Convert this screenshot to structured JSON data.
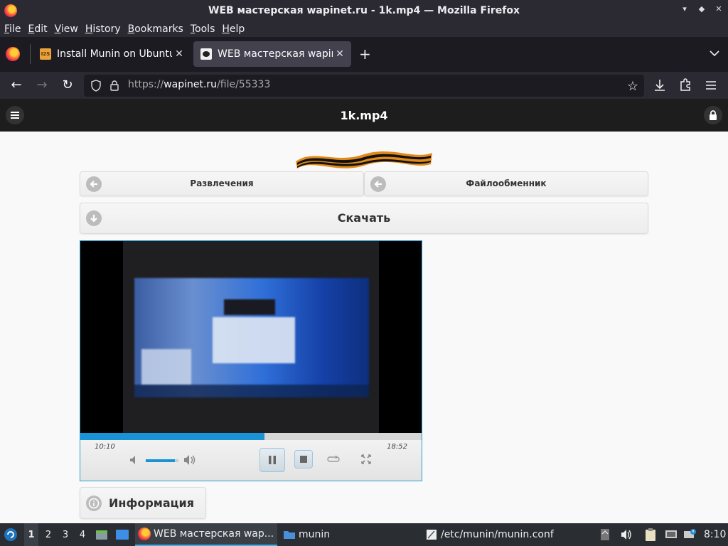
{
  "window": {
    "title": "WEB мастерская wapinet.ru - 1k.mp4 — Mozilla Firefox"
  },
  "menubar": [
    "File",
    "Edit",
    "View",
    "History",
    "Bookmarks",
    "Tools",
    "Help"
  ],
  "tabs": [
    {
      "label": "Install Munin on Ubuntu",
      "favicon": "i2s-icon",
      "active": false
    },
    {
      "label": "WEB мастерская wapinet.ru",
      "favicon": "wapinet-icon",
      "active": true
    }
  ],
  "urlbar": {
    "protocol": "https://",
    "host": "wapinet.ru",
    "path": "/file/55333"
  },
  "site": {
    "page_title": "1k.mp4",
    "nav_left": "Развлечения",
    "nav_right": "Файлообменник",
    "download": "Скачать",
    "info": "Информация"
  },
  "player": {
    "elapsed": "10:10",
    "duration": "18:52",
    "progress_fraction": 0.539,
    "volume_fraction": 0.9,
    "state": "playing"
  },
  "taskbar": {
    "workspaces": [
      "1",
      "2",
      "3",
      "4"
    ],
    "active_workspace": "1",
    "windows": [
      {
        "label": "WEB мастерская wap...",
        "active": true
      },
      {
        "label": "munin",
        "active": false
      },
      {
        "label": "/etc/munin/munin.conf",
        "active": false
      }
    ],
    "clock": "8:10"
  },
  "colors": {
    "accent": "#1a93d6",
    "chrome_dark": "#2b2a33",
    "site_header": "#1d1d1d"
  }
}
